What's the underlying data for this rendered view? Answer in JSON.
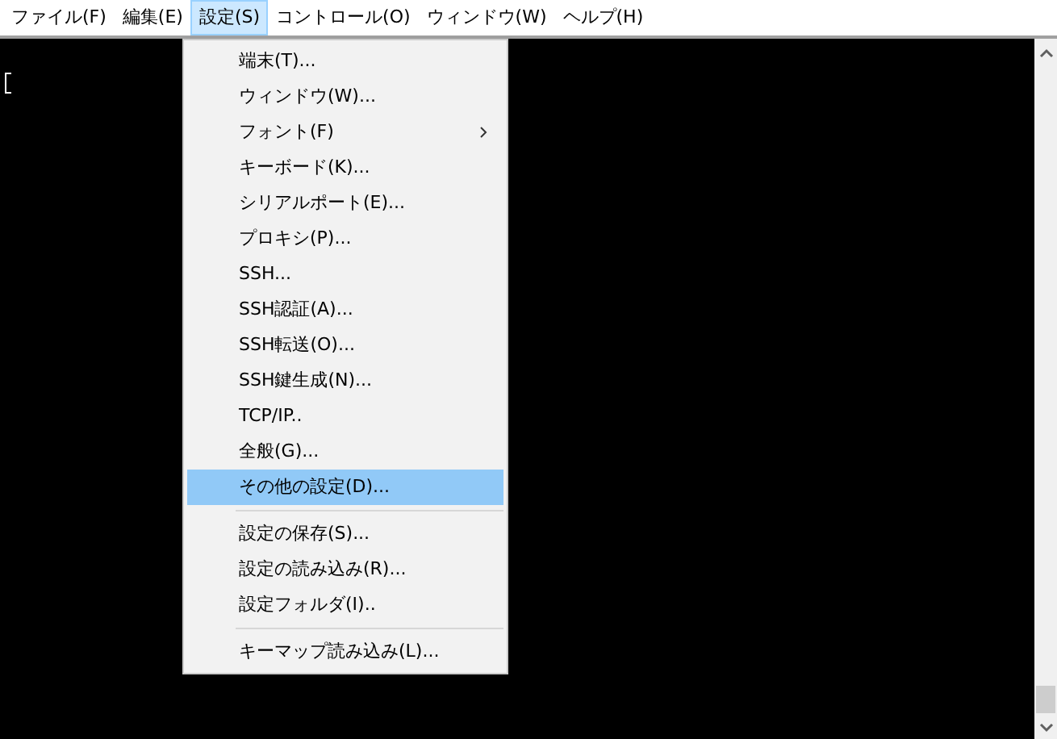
{
  "menu_bar": [
    {
      "label": "ファイル(F)",
      "selected": false
    },
    {
      "label": "編集(E)",
      "selected": false
    },
    {
      "label": "設定(S)",
      "selected": true
    },
    {
      "label": "コントロール(O)",
      "selected": false
    },
    {
      "label": "ウィンドウ(W)",
      "selected": false
    },
    {
      "label": "ヘルプ(H)",
      "selected": false
    }
  ],
  "dropdown_menu": [
    {
      "kind": "item",
      "label": "端末(T)...",
      "selected": false
    },
    {
      "kind": "item",
      "label": "ウィンドウ(W)...",
      "selected": false
    },
    {
      "kind": "item",
      "label": "フォント(F)",
      "selected": false,
      "submenu": true
    },
    {
      "kind": "item",
      "label": "キーボード(K)...",
      "selected": false
    },
    {
      "kind": "item",
      "label": "シリアルポート(E)...",
      "selected": false
    },
    {
      "kind": "item",
      "label": "プロキシ(P)...",
      "selected": false
    },
    {
      "kind": "item",
      "label": "SSH...",
      "selected": false
    },
    {
      "kind": "item",
      "label": "SSH認証(A)...",
      "selected": false
    },
    {
      "kind": "item",
      "label": "SSH転送(O)...",
      "selected": false
    },
    {
      "kind": "item",
      "label": "SSH鍵生成(N)...",
      "selected": false
    },
    {
      "kind": "item",
      "label": "TCP/IP..",
      "selected": false
    },
    {
      "kind": "item",
      "label": "全般(G)...",
      "selected": false
    },
    {
      "kind": "item",
      "label": "その他の設定(D)...",
      "selected": true
    },
    {
      "kind": "separator"
    },
    {
      "kind": "item",
      "label": "設定の保存(S)...",
      "selected": false
    },
    {
      "kind": "item",
      "label": "設定の読み込み(R)...",
      "selected": false
    },
    {
      "kind": "item",
      "label": "設定フォルダ(I)..",
      "selected": false
    },
    {
      "kind": "separator"
    },
    {
      "kind": "item",
      "label": "キーマップ読み込み(L)...",
      "selected": false
    }
  ]
}
